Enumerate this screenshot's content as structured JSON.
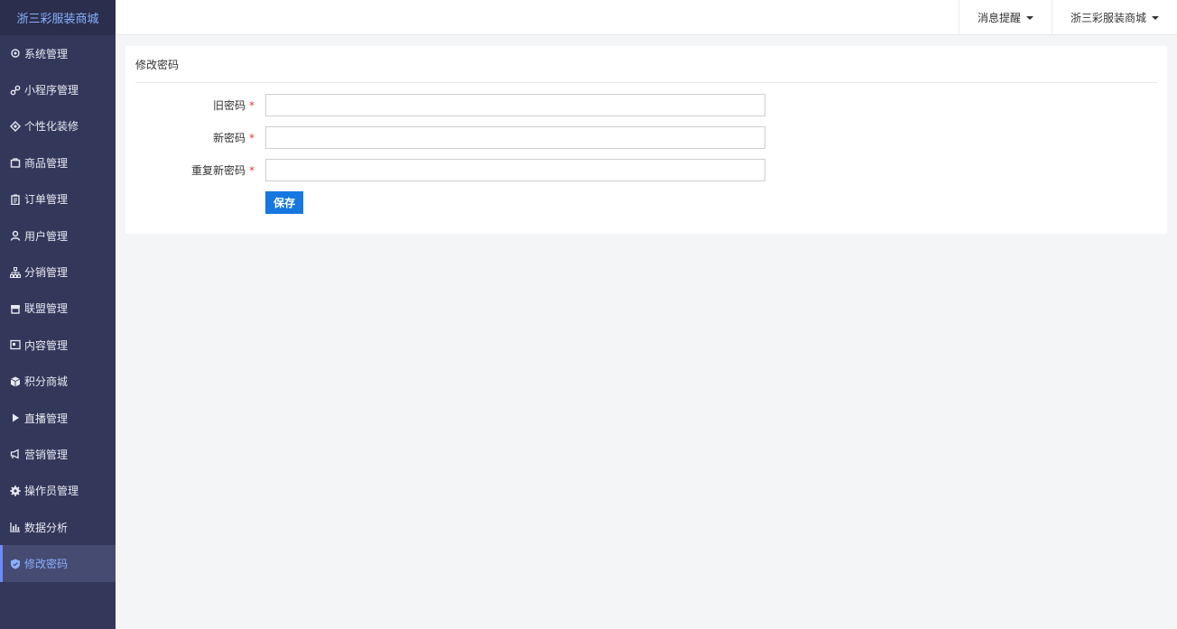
{
  "brand": "浙三彩服装商城",
  "sidebar": {
    "items": [
      {
        "label": "系统管理",
        "icon": "gear-outline-icon"
      },
      {
        "label": "小程序管理",
        "icon": "link-icon"
      },
      {
        "label": "个性化装修",
        "icon": "diamond-icon"
      },
      {
        "label": "商品管理",
        "icon": "bag-icon"
      },
      {
        "label": "订单管理",
        "icon": "clipboard-icon"
      },
      {
        "label": "用户管理",
        "icon": "user-icon"
      },
      {
        "label": "分销管理",
        "icon": "hierarchy-icon"
      },
      {
        "label": "联盟管理",
        "icon": "store-icon"
      },
      {
        "label": "内容管理",
        "icon": "content-icon"
      },
      {
        "label": "积分商城",
        "icon": "cube-icon"
      },
      {
        "label": "直播管理",
        "icon": "play-icon"
      },
      {
        "label": "营销管理",
        "icon": "megaphone-icon"
      },
      {
        "label": "操作员管理",
        "icon": "gear-solid-icon"
      },
      {
        "label": "数据分析",
        "icon": "bar-chart-icon"
      },
      {
        "label": "修改密码",
        "icon": "shield-icon",
        "active": true
      }
    ]
  },
  "topbar": {
    "notifications": "消息提醒",
    "account": "浙三彩服装商城"
  },
  "form": {
    "title": "修改密码",
    "old_password_label": "旧密码",
    "new_password_label": "新密码",
    "repeat_password_label": "重复新密码",
    "required_mark": "*",
    "old_password_value": "",
    "new_password_value": "",
    "repeat_password_value": "",
    "save_label": "保存"
  },
  "colors": {
    "sidebar_bg": "#33375a",
    "brand_text": "#8ab0ff",
    "primary_button": "#1677e0",
    "required_star": "#e4393c"
  }
}
